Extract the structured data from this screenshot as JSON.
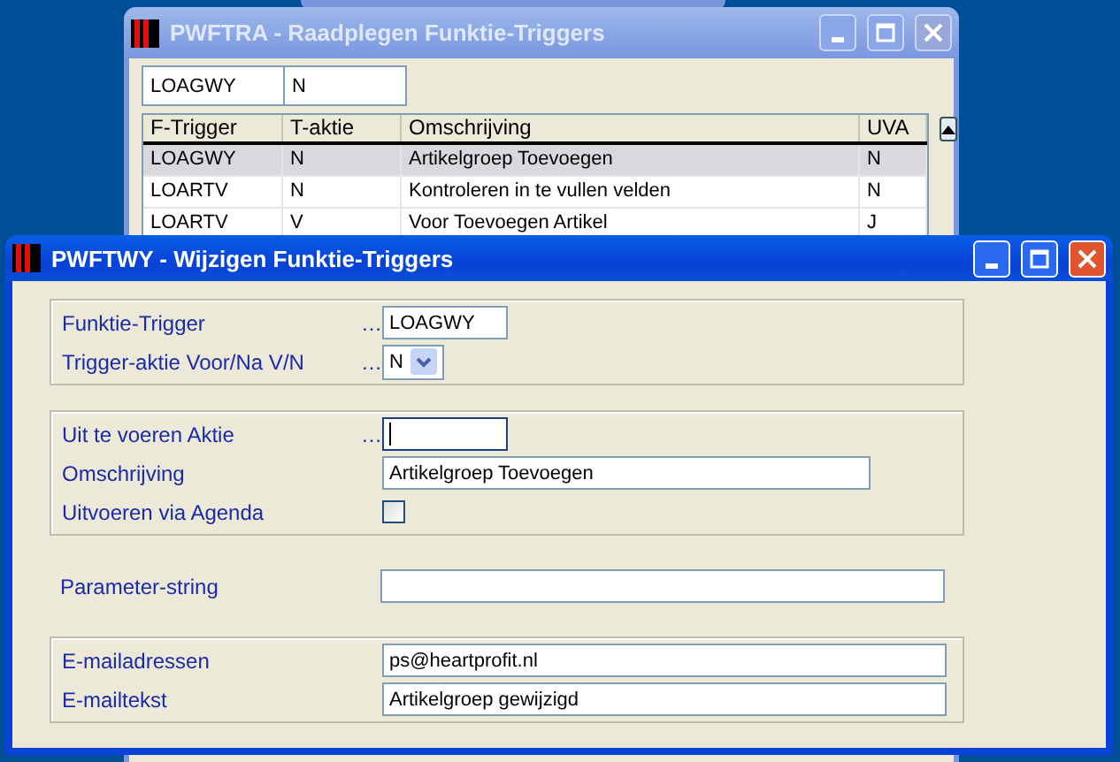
{
  "windows": [
    {
      "title": "PWFTRA - Raadplegen Funktie-Triggers",
      "active": false,
      "filter": [
        "LOAGWY",
        "N"
      ],
      "table": {
        "columns": [
          "F-Trigger",
          "T-aktie",
          "Omschrijving",
          "UVA"
        ],
        "rows": [
          {
            "cells": [
              "LOAGWY",
              "N",
              "Artikelgroep Toevoegen",
              "N"
            ],
            "selected": true
          },
          {
            "cells": [
              "LOARTV",
              "N",
              "Kontroleren in te vullen velden",
              "N"
            ],
            "selected": false
          },
          {
            "cells": [
              "LOARTV",
              "V",
              "Voor Toevoegen Artikel",
              "J"
            ],
            "selected": false
          }
        ]
      }
    },
    {
      "title": "PWFTWY - Wijzigen Funktie-Triggers",
      "active": true,
      "groups": [
        {
          "boxed": true,
          "fields": [
            {
              "kind": "code",
              "label": "Funktie-Trigger",
              "lookup": "…",
              "value": "LOAGWY",
              "focused": false
            },
            {
              "kind": "select",
              "label": "Trigger-aktie Voor/Na V/N",
              "lookup": "…",
              "value": "N",
              "focused": false
            }
          ]
        },
        {
          "boxed": true,
          "fields": [
            {
              "kind": "code",
              "label": "Uit te voeren Aktie",
              "lookup": "…",
              "focused": true
            },
            {
              "kind": "text",
              "label": "Omschrijving",
              "value": "Artikelgroep Toevoegen",
              "focused": false
            },
            {
              "kind": "checkbox",
              "label": "Uitvoeren via Agenda",
              "checked": false,
              "focused": false
            }
          ]
        },
        {
          "boxed": false,
          "fields": [
            {
              "kind": "text",
              "label": "Parameter-string",
              "focused": false
            }
          ]
        },
        {
          "boxed": true,
          "fields": [
            {
              "kind": "text",
              "label": "E-mailadressen",
              "value": "ps@heartprofit.nl",
              "focused": false
            },
            {
              "kind": "text",
              "label": "E-mailtekst",
              "value": "Artikelgroep gewijzigd",
              "focused": false
            }
          ]
        }
      ]
    }
  ]
}
